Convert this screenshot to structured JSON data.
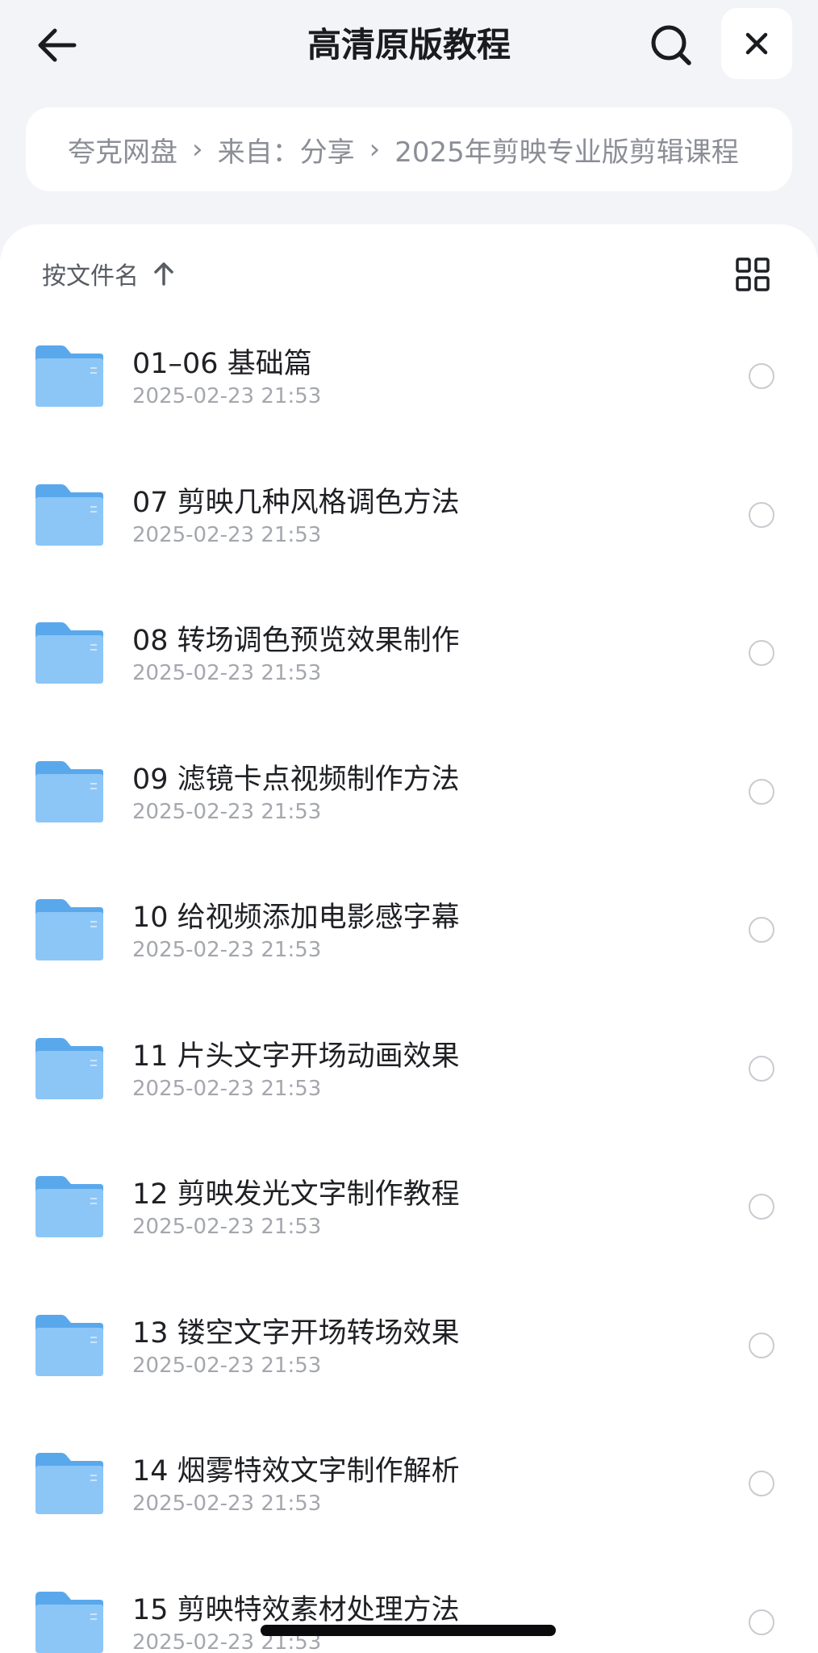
{
  "header": {
    "title": "高清原版教程"
  },
  "breadcrumb": {
    "items": [
      "夸克网盘",
      "来自：分享",
      "2025年剪映专业版剪辑课程"
    ]
  },
  "sort": {
    "label": "按文件名"
  },
  "files": [
    {
      "name": "01–06 基础篇",
      "date": "2025-02-23 21:53"
    },
    {
      "name": "07  剪映几种风格调色方法",
      "date": "2025-02-23 21:53"
    },
    {
      "name": "08  转场调色预览效果制作",
      "date": "2025-02-23 21:53"
    },
    {
      "name": "09  滤镜卡点视频制作方法",
      "date": "2025-02-23 21:53"
    },
    {
      "name": "10  给视频添加电影感字幕",
      "date": "2025-02-23 21:53"
    },
    {
      "name": "11  片头文字开场动画效果",
      "date": "2025-02-23 21:53"
    },
    {
      "name": "12  剪映发光文字制作教程",
      "date": "2025-02-23 21:53"
    },
    {
      "name": "13  镂空文字开场转场效果",
      "date": "2025-02-23 21:53"
    },
    {
      "name": "14  烟雾特效文字制作解析",
      "date": "2025-02-23 21:53"
    },
    {
      "name": "15  剪映特效素材处理方法",
      "date": "2025-02-23 21:53"
    }
  ],
  "colors": {
    "folder_back": "#5aa8ec",
    "folder_front": "#8cc6f7",
    "background": "#f3f4f7"
  },
  "icons": {
    "back": "arrow-left-icon",
    "search": "search-icon",
    "close": "close-icon",
    "sort": "arrow-up-icon",
    "view": "grid-view-icon",
    "folder": "folder-icon"
  }
}
